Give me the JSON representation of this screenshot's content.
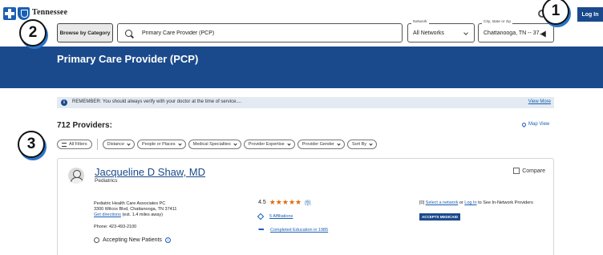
{
  "header": {
    "logo_text": "Tennessee",
    "login_label": "Log In",
    "browse_label": "Browse by Category",
    "search": {
      "value": "Primary Care Provider (PCP)"
    },
    "network": {
      "label": "Network",
      "value": "All Networks"
    },
    "location": {
      "label": "City, state or zip",
      "value": "Chattanooga, TN -- 37..."
    }
  },
  "callouts": {
    "c1": "1",
    "c2": "2",
    "c3": "3"
  },
  "page_title": "Primary Care Provider (PCP)",
  "notice": {
    "text": "REMEMBER: You should always verify with your doctor at the time of service....",
    "link": "View More"
  },
  "results": {
    "count": "712 Providers:",
    "map_view": "Map View"
  },
  "filters": {
    "all": "All Filters",
    "items": [
      "Distance",
      "People or Places",
      "Medical Specialties",
      "Provider Expertise",
      "Provider Gender",
      "Sort By"
    ]
  },
  "provider": {
    "name": "Jacqueline D Shaw, MD",
    "specialty": "Pediatrics",
    "compare": "Compare",
    "practice": "Pediatric Health Care Associates PC",
    "address": "3300 Wilcox Blvd, Chattanooga, TN 37411",
    "directions": "Get directions",
    "distance": "(est. 1.4 miles away)",
    "phone": "Phone: 423-493-2100",
    "accepting": "Accepting New Patients",
    "rating": "4.5",
    "stars": "★★★★★",
    "reviews": "(6)",
    "affiliations": "5 Affiliations",
    "education": "Completed Education in 1985",
    "network_prefix": "[0]",
    "select_network": "Select a network",
    "or": "or",
    "log_in": "Log In",
    "network_suffix": "to See In-Network Providers",
    "badge": "ACCEPTS MEDICAID"
  },
  "colors": {
    "brand_blue": "#1b4a8c",
    "star_orange": "#e26b0a",
    "link_blue": "#1a5fb4"
  }
}
